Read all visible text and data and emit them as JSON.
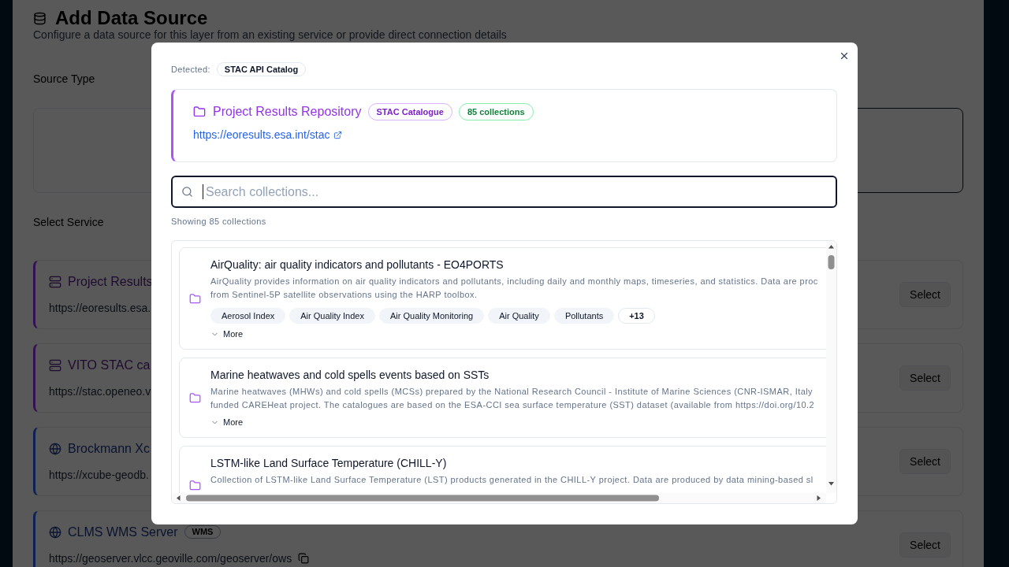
{
  "page": {
    "title": "Add Data Source",
    "subtitle": "Configure a data source for this layer from an existing service or provide direct connection details",
    "source_type_label": "Source Type",
    "source_types": [
      {
        "selected": false
      },
      {
        "selected": true
      }
    ],
    "service_label": "Select Service",
    "services": [
      {
        "kind": "stac",
        "name": "Project Results",
        "url": "https://eoresults.esa.",
        "button": "Select"
      },
      {
        "kind": "stac",
        "name": "VITO STAC ca",
        "url": "https://stac.openeo.v",
        "button": "Select"
      },
      {
        "kind": "ogc",
        "name": "Brockmann Xc",
        "url": "https://xcube-geodb.",
        "button": "Select"
      },
      {
        "kind": "ogc",
        "name": "CLMS WMS Server",
        "badge": "WMS",
        "url": "https://geoserver.vlcc.geoville.com/geoserver/ows",
        "copyable": true,
        "button": "Select"
      }
    ]
  },
  "dialog": {
    "detected_label": "Detected:",
    "detected_type": "STAC API Catalog",
    "catalog": {
      "title": "Project Results Repository",
      "badges": [
        {
          "kind": "type",
          "text": "STAC Catalogue"
        },
        {
          "kind": "count",
          "text": "85 collections"
        }
      ],
      "url": "https://eoresults.esa.int/stac"
    },
    "search": {
      "placeholder": "Search collections...",
      "focused": true
    },
    "result_count": "Showing 85 collections",
    "collections": [
      {
        "title": "AirQuality: air quality indicators and pollutants - EO4PORTS",
        "description_lines": [
          "AirQuality provides information on air quality indicators and pollutants, including daily and monthly maps, timeseries, and statistics. Data are proc",
          "from Sentinel-5P satellite observations using the HARP toolbox."
        ],
        "tags": [
          "Aerosol Index",
          "Air Quality Index",
          "Air Quality Monitoring",
          "Air Quality",
          "Pollutants"
        ],
        "more_tags": "+13",
        "toggle": "More"
      },
      {
        "title": "Marine heatwaves and cold spells events based on SSTs",
        "description_lines": [
          "Marine heatwaves (MHWs) and cold spells (MCSs) prepared by the National Research Council - Institute of Marine Sciences (CNR-ISMAR, Italy",
          "funded CAREHeat project. The catalogues are based on the ESA-CCI sea surface temperature (SST) dataset (available from https://doi.org/10.2"
        ],
        "toggle": "More"
      },
      {
        "title": "LSTM-like Land Surface Temperature (CHILL-Y)",
        "description_lines": [
          "Collection of LSTM-like Land Surface Temperature (LST) products generated in the CHILL-Y project. Data are produced by data mining-based sl"
        ]
      }
    ]
  }
}
